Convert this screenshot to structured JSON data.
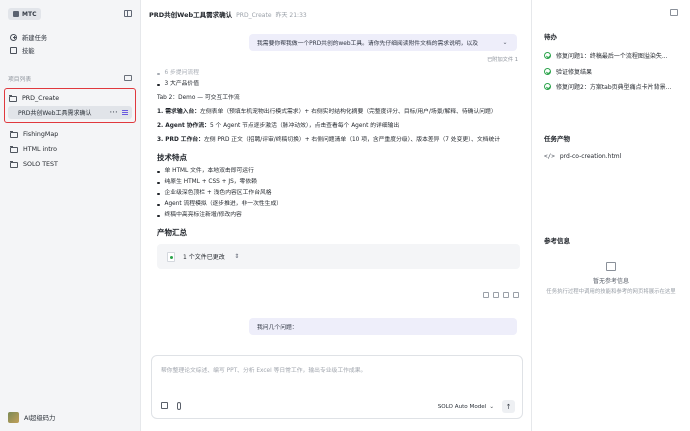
{
  "sidebar": {
    "brand": "MTC",
    "nav": [
      {
        "label": "新建任务",
        "icon": "plus-circle-icon"
      },
      {
        "label": "技能",
        "icon": "skill-icon"
      }
    ],
    "section_label": "项目列表",
    "projects": [
      {
        "name": "PRD_Create",
        "active": true,
        "tasks": [
          {
            "label": "PRD共创Web工具需求确认"
          }
        ]
      },
      {
        "name": "FishingMap"
      },
      {
        "name": "HTML intro"
      },
      {
        "name": "SOLO TEST"
      }
    ],
    "user": "AI超级码力"
  },
  "main": {
    "title": "PRD共创Web工具需求确认",
    "project": "PRD_Create",
    "time": "昨天 21:33",
    "user_message": "我需要你帮我做一个PRD共创的web工具。请你先仔细阅读附件文档的需求说明，以及",
    "context_note": "已附加文件 1",
    "faded_bullet": "6 步提问流程",
    "bullet_value": "3 大产品价值",
    "tab2_heading": "Tab 2：Demo — 可交互工作流",
    "steps": [
      {
        "bold": "1. 需求输入台：",
        "text": "左侧表单（预填车机宠物出行模式需求）+ 右侧实时结构化摘要（完整度评分、目标/用户/场景/解释、待确认问题）"
      },
      {
        "bold": "2. Agent 协作流：",
        "text": "5 个 Agent 节点逐步激活（脉冲动效），点击查看每个 Agent 的详细输出"
      },
      {
        "bold": "3. PRD 工作台：",
        "text": "左侧 PRD 正文（招聘/评审/终稿切换）+ 右侧问题清单（10 项，含严重度分级）、版本差异（7 处变更）、文档统计"
      }
    ],
    "features_heading": "技术特点",
    "features": [
      "单 HTML 文件，本地双击即可运行",
      "纯原生 HTML + CSS + JS，零依赖",
      "企业级深色顶栏 + 浅色内容区工作台风格",
      "Agent 流程模拟（逐步推进，非一次性生成）",
      "终稿中高亮标注新增/修改内容"
    ],
    "output_heading": "产物汇总",
    "file_change": "1 个文件已更改",
    "followup_message": "我问几个问题：",
    "composer_placeholder": "帮你整理论文综述、编写 PPT、分析 Excel 等日常工作，输出专业级工作成果。",
    "model": "SOLO Auto Model"
  },
  "right": {
    "todo_title": "待办",
    "todos": [
      "修复问题1：终稿最后一个流程图溢染失...",
      "验证修复结果",
      "修复问题2：方案tab页典型痛点卡片背景..."
    ],
    "artifacts_title": "任务产物",
    "artifact": "prd-co-creation.html",
    "ref_title": "参考信息",
    "ref_empty_title": "暂无参考信息",
    "ref_empty_desc": "任务执行过程中调用的技能和参考的网页将展示在这里"
  }
}
